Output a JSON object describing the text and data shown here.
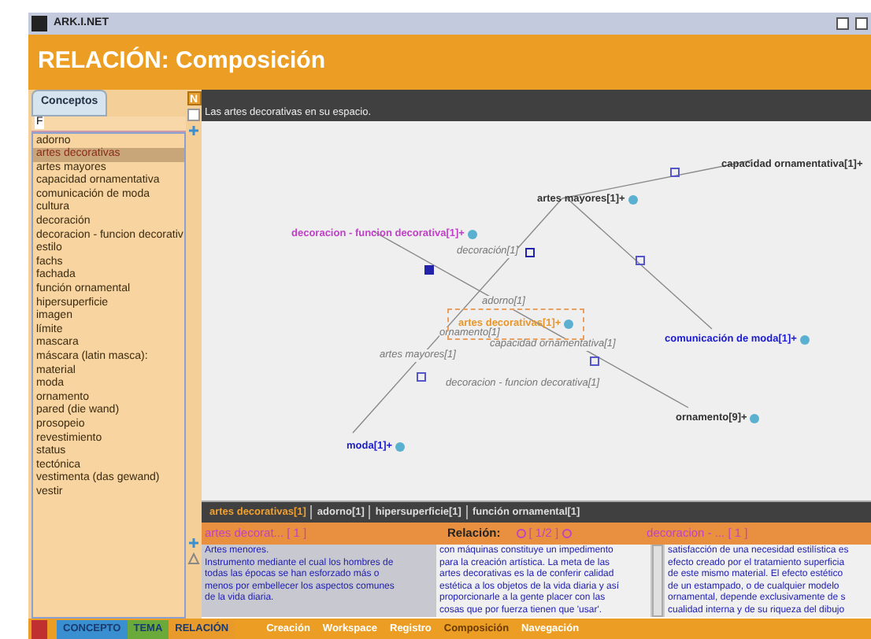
{
  "window": {
    "title": "ARK.I.NET"
  },
  "header": {
    "title": "RELACIÓN: Composición"
  },
  "sidebar": {
    "tab": "Conceptos",
    "filter": "F",
    "items": [
      {
        "label": "adorno",
        "selected": false
      },
      {
        "label": "artes decorativas",
        "selected": true
      },
      {
        "label": "artes mayores",
        "selected": false
      },
      {
        "label": "capacidad ornamentativa",
        "selected": false
      },
      {
        "label": "comunicación de moda",
        "selected": false
      },
      {
        "label": "cultura",
        "selected": false
      },
      {
        "label": "decoración",
        "selected": false
      },
      {
        "label": "decoracion - funcion decorativ",
        "selected": false
      },
      {
        "label": "estilo",
        "selected": false
      },
      {
        "label": "fachs",
        "selected": false
      },
      {
        "label": "fachada",
        "selected": false
      },
      {
        "label": "función ornamental",
        "selected": false
      },
      {
        "label": "hipersuperficie",
        "selected": false
      },
      {
        "label": "imagen",
        "selected": false
      },
      {
        "label": "límite",
        "selected": false
      },
      {
        "label": "mascara",
        "selected": false
      },
      {
        "label": "máscara (latin masca):",
        "selected": false
      },
      {
        "label": "material",
        "selected": false
      },
      {
        "label": "moda",
        "selected": false
      },
      {
        "label": "ornamento",
        "selected": false
      },
      {
        "label": "pared (die wand)",
        "selected": false
      },
      {
        "label": "prosopeio",
        "selected": false
      },
      {
        "label": "revestimiento",
        "selected": false
      },
      {
        "label": "status",
        "selected": false
      },
      {
        "label": "tectónica",
        "selected": false
      },
      {
        "label": "vestimenta (das gewand)",
        "selected": false
      },
      {
        "label": "vestir",
        "selected": false
      }
    ]
  },
  "tool_icons": [
    "N"
  ],
  "description": "Las artes decorativas en su espacio.",
  "graph": {
    "nodes": [
      {
        "label": "capacidad ornamentativa[1]+",
        "color": "#333333",
        "selected": false
      },
      {
        "label": "artes mayores[1]+",
        "color": "#333333",
        "selected": false
      },
      {
        "label": "decoracion - funcion decorativa[1]+",
        "color": "#c040c8",
        "selected": false
      },
      {
        "label": "artes decorativas[1]+",
        "color": "#e8962a",
        "selected": true
      },
      {
        "label": "comunicación de moda[1]+",
        "color": "#1a1ad0",
        "selected": false
      },
      {
        "label": "ornamento[9]+",
        "color": "#333333",
        "selected": false
      },
      {
        "label": "moda[1]+",
        "color": "#1a1ad0",
        "selected": false
      }
    ],
    "edge_labels": [
      "decoración[1]",
      "adorno[1]",
      "ornamento[1]",
      "artes mayores[1]",
      "capacidad ornamentativa[1]",
      "decoracion - funcion decorativa[1]"
    ]
  },
  "related_links": [
    "artes decorativas[1]",
    "adorno[1]",
    "hipersuperficie[1]",
    "función ornamental[1]"
  ],
  "panels": {
    "left_heading": "artes decorat... [ 1 ]",
    "relation_label": "Relación:",
    "relation_count": "[ 1/2 ]",
    "right_heading": "decoracion - ... [ 1 ]",
    "left_text": [
      "Artes menores.",
      "Instrumento mediante el cual los hombres de",
      "todas las épocas se han esforzado más o",
      "menos por embellecer los aspectos comunes",
      "de la vida diaria."
    ],
    "middle_text": [
      "con máquinas constituye un impedimento",
      "para la creación artística. La meta de las",
      "artes decorativas es la de conferir calidad",
      "estética a los objetos de la vida diaria y así",
      "proporcionarle a la gente placer con las",
      "cosas que por fuerza tienen que 'usar'."
    ],
    "right_text": [
      "satisfacción de una necesidad estilística es",
      "efecto creado por el tratamiento superficia",
      "de este mismo material. El efecto estético",
      "de un estampado, o de cualquier modelo",
      "ornamental, depende exclusivamente de s",
      "cualidad interna y de su riqueza del dibujo"
    ]
  },
  "bottom_tabs": [
    {
      "label": "CONCEPTO",
      "kind": "concept"
    },
    {
      "label": "TEMA",
      "kind": "theme"
    },
    {
      "label": "RELACIÓN",
      "kind": "relation"
    }
  ],
  "menu": [
    {
      "label": "Creación",
      "selected": false
    },
    {
      "label": "Workspace",
      "selected": false
    },
    {
      "label": "Registro",
      "selected": false
    },
    {
      "label": "Composición",
      "selected": true
    },
    {
      "label": "Navegación",
      "selected": false
    }
  ]
}
